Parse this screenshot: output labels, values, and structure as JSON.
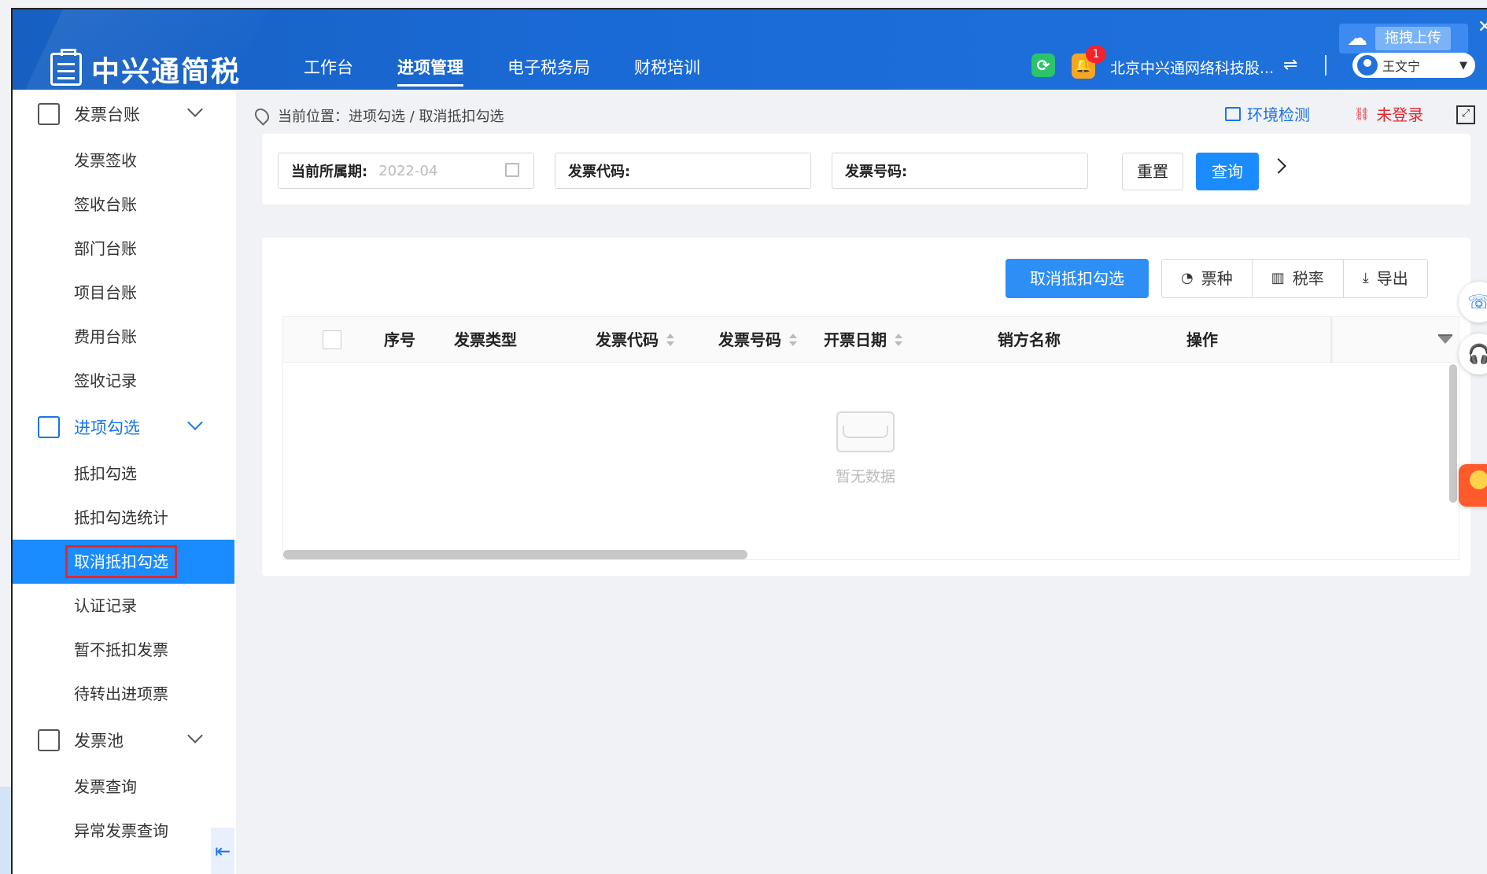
{
  "app": {
    "logo_text": "中兴通简税",
    "nav": [
      "工作台",
      "进项管理",
      "电子税务局",
      "财税培训"
    ],
    "active_nav_index": 1,
    "notification_count": "1",
    "company": "北京中兴通网络科技股...",
    "user": "王文宁",
    "upload_label": "拖拽上传"
  },
  "sidebar": {
    "groups": [
      {
        "label": "发票台账",
        "items": [
          "发票签收",
          "签收台账",
          "部门台账",
          "项目台账",
          "费用台账",
          "签收记录"
        ]
      },
      {
        "label": "进项勾选",
        "items": [
          "抵扣勾选",
          "抵扣勾选统计",
          "取消抵扣勾选",
          "认证记录",
          "暂不抵扣发票",
          "待转出进项票"
        ]
      },
      {
        "label": "发票池",
        "items": [
          "发票查询",
          "异常发票查询"
        ]
      }
    ],
    "active_item": "取消抵扣勾选"
  },
  "breadcrumb": "当前位置：进项勾选 / 取消抵扣勾选",
  "header_links": {
    "env_check": "环境检测",
    "not_login": "未登录"
  },
  "filters": {
    "period_label": "当前所属期:",
    "period_value": "2022-04",
    "invoice_code_label": "发票代码:",
    "invoice_number_label": "发票号码:",
    "reset": "重置",
    "query": "查询"
  },
  "actions": {
    "cancel_deduct": "取消抵扣勾选",
    "invoice_type": "票种",
    "tax_rate": "税率",
    "export": "导出"
  },
  "table": {
    "columns": [
      "序号",
      "发票类型",
      "发票代码",
      "发票号码",
      "开票日期",
      "销方名称",
      "操作"
    ],
    "empty_text": "暂无数据"
  },
  "colors": {
    "header_blue": "#1a6ad6",
    "primary": "#1a8cff",
    "danger": "#e5262d",
    "refresh_green": "#2cc36b",
    "bell_orange": "#f6a623"
  }
}
